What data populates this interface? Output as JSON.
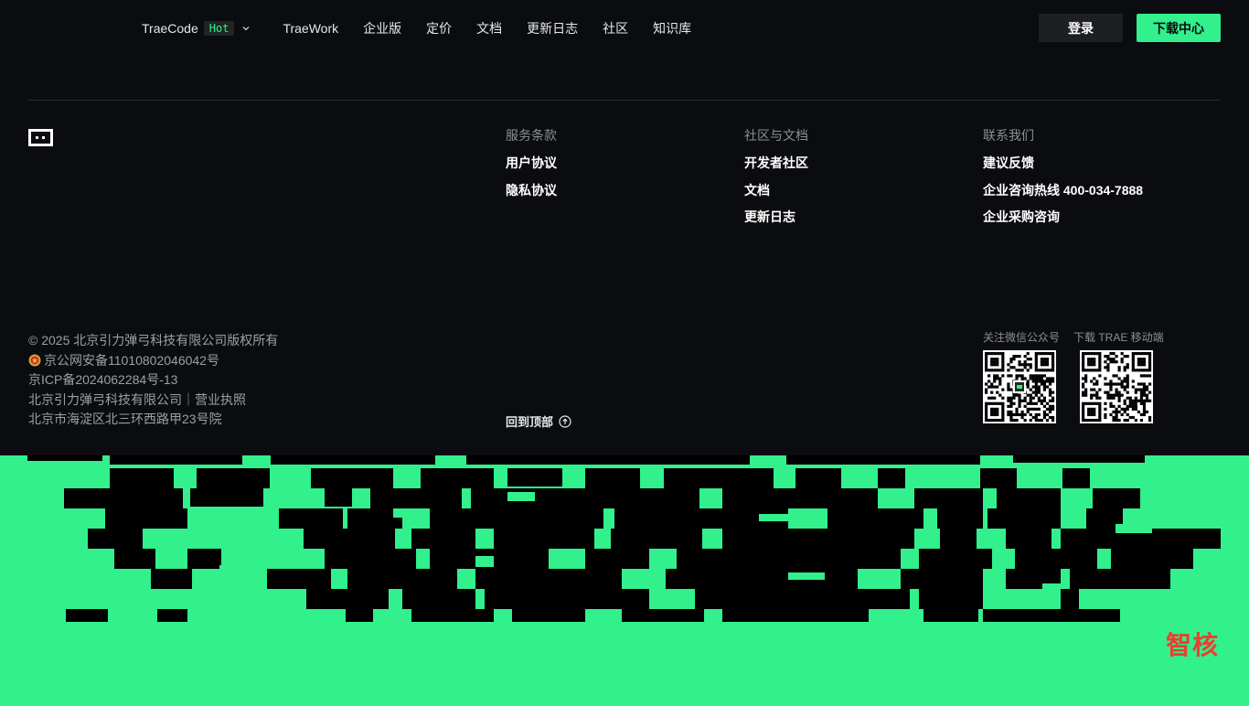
{
  "nav": {
    "items": [
      {
        "label": "TraeCode",
        "badge": "Hot",
        "has_dropdown": true
      },
      {
        "label": "TraeWork"
      },
      {
        "label": "企业版"
      },
      {
        "label": "定价"
      },
      {
        "label": "文档"
      },
      {
        "label": "更新日志"
      },
      {
        "label": "社区"
      },
      {
        "label": "知识库"
      }
    ],
    "login_label": "登录",
    "download_label": "下载中心"
  },
  "footer": {
    "columns": [
      {
        "title": "服务条款",
        "links": [
          "用户协议",
          "隐私协议"
        ]
      },
      {
        "title": "社区与文档",
        "links": [
          "开发者社区",
          "文档",
          "更新日志"
        ]
      },
      {
        "title": "联系我们",
        "links": [
          "建议反馈",
          "企业咨询热线 400-034-7888",
          "企业采购咨询"
        ]
      }
    ],
    "legal": {
      "copyright": "© 2025 北京引力弹弓科技有限公司版权所有",
      "police": "京公网安备11010802046042号",
      "icp": "京ICP备2024062284号-13",
      "company": "北京引力弹弓科技有限公司｜营业执照",
      "address": "北京市海淀区北三环西路甲23号院"
    },
    "back_to_top": "回到顶部",
    "qr": {
      "wechat_label": "关注微信公众号",
      "mobile_label": "下载 TRAE 移动端"
    }
  },
  "watermark": "智核",
  "colors": {
    "background": "#0b0c0f",
    "accent": "#32f08c",
    "watermark": "#ea3f2f"
  },
  "icons": [
    "chevron-down-icon",
    "trae-logo-icon",
    "police-emblem-icon",
    "arrow-up-circle-icon",
    "qr-code-icon"
  ]
}
